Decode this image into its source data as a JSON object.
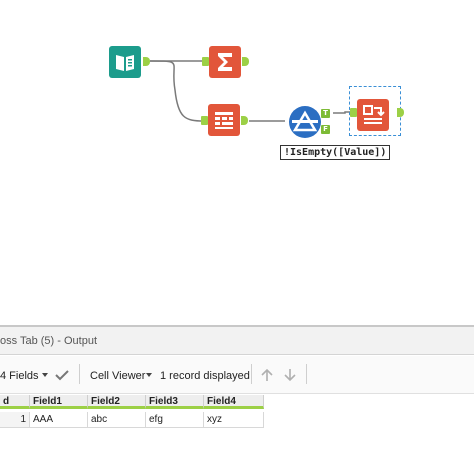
{
  "workflow": {
    "filter_expression": "!IsEmpty([Value])",
    "filter_true_label": "T",
    "filter_false_label": "F"
  },
  "results": {
    "title": "oss Tab (5) - Output",
    "fields_label": "4 Fields",
    "cell_viewer_label": "Cell Viewer",
    "records_label": "1 record displayed",
    "columns": [
      "d",
      "Field1",
      "Field2",
      "Field3",
      "Field4"
    ],
    "rows": [
      [
        "1",
        "AAA",
        "abc",
        "efg",
        "xyz"
      ]
    ]
  },
  "colors": {
    "input_tool": "#1c9c8c",
    "transform_tool": "#e2563a",
    "filter_tool": "#2b6ec2",
    "anchor": "#9cd046"
  }
}
